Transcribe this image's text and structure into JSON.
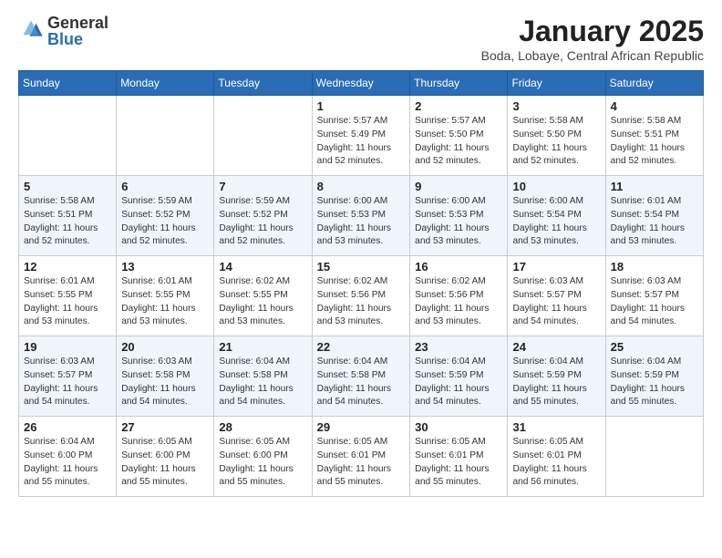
{
  "logo": {
    "general": "General",
    "blue": "Blue"
  },
  "title": "January 2025",
  "location": "Boda, Lobaye, Central African Republic",
  "days_of_week": [
    "Sunday",
    "Monday",
    "Tuesday",
    "Wednesday",
    "Thursday",
    "Friday",
    "Saturday"
  ],
  "weeks": [
    [
      {
        "day": "",
        "info": ""
      },
      {
        "day": "",
        "info": ""
      },
      {
        "day": "",
        "info": ""
      },
      {
        "day": "1",
        "info": "Sunrise: 5:57 AM\nSunset: 5:49 PM\nDaylight: 11 hours\nand 52 minutes."
      },
      {
        "day": "2",
        "info": "Sunrise: 5:57 AM\nSunset: 5:50 PM\nDaylight: 11 hours\nand 52 minutes."
      },
      {
        "day": "3",
        "info": "Sunrise: 5:58 AM\nSunset: 5:50 PM\nDaylight: 11 hours\nand 52 minutes."
      },
      {
        "day": "4",
        "info": "Sunrise: 5:58 AM\nSunset: 5:51 PM\nDaylight: 11 hours\nand 52 minutes."
      }
    ],
    [
      {
        "day": "5",
        "info": "Sunrise: 5:58 AM\nSunset: 5:51 PM\nDaylight: 11 hours\nand 52 minutes."
      },
      {
        "day": "6",
        "info": "Sunrise: 5:59 AM\nSunset: 5:52 PM\nDaylight: 11 hours\nand 52 minutes."
      },
      {
        "day": "7",
        "info": "Sunrise: 5:59 AM\nSunset: 5:52 PM\nDaylight: 11 hours\nand 52 minutes."
      },
      {
        "day": "8",
        "info": "Sunrise: 6:00 AM\nSunset: 5:53 PM\nDaylight: 11 hours\nand 53 minutes."
      },
      {
        "day": "9",
        "info": "Sunrise: 6:00 AM\nSunset: 5:53 PM\nDaylight: 11 hours\nand 53 minutes."
      },
      {
        "day": "10",
        "info": "Sunrise: 6:00 AM\nSunset: 5:54 PM\nDaylight: 11 hours\nand 53 minutes."
      },
      {
        "day": "11",
        "info": "Sunrise: 6:01 AM\nSunset: 5:54 PM\nDaylight: 11 hours\nand 53 minutes."
      }
    ],
    [
      {
        "day": "12",
        "info": "Sunrise: 6:01 AM\nSunset: 5:55 PM\nDaylight: 11 hours\nand 53 minutes."
      },
      {
        "day": "13",
        "info": "Sunrise: 6:01 AM\nSunset: 5:55 PM\nDaylight: 11 hours\nand 53 minutes."
      },
      {
        "day": "14",
        "info": "Sunrise: 6:02 AM\nSunset: 5:55 PM\nDaylight: 11 hours\nand 53 minutes."
      },
      {
        "day": "15",
        "info": "Sunrise: 6:02 AM\nSunset: 5:56 PM\nDaylight: 11 hours\nand 53 minutes."
      },
      {
        "day": "16",
        "info": "Sunrise: 6:02 AM\nSunset: 5:56 PM\nDaylight: 11 hours\nand 53 minutes."
      },
      {
        "day": "17",
        "info": "Sunrise: 6:03 AM\nSunset: 5:57 PM\nDaylight: 11 hours\nand 54 minutes."
      },
      {
        "day": "18",
        "info": "Sunrise: 6:03 AM\nSunset: 5:57 PM\nDaylight: 11 hours\nand 54 minutes."
      }
    ],
    [
      {
        "day": "19",
        "info": "Sunrise: 6:03 AM\nSunset: 5:57 PM\nDaylight: 11 hours\nand 54 minutes."
      },
      {
        "day": "20",
        "info": "Sunrise: 6:03 AM\nSunset: 5:58 PM\nDaylight: 11 hours\nand 54 minutes."
      },
      {
        "day": "21",
        "info": "Sunrise: 6:04 AM\nSunset: 5:58 PM\nDaylight: 11 hours\nand 54 minutes."
      },
      {
        "day": "22",
        "info": "Sunrise: 6:04 AM\nSunset: 5:58 PM\nDaylight: 11 hours\nand 54 minutes."
      },
      {
        "day": "23",
        "info": "Sunrise: 6:04 AM\nSunset: 5:59 PM\nDaylight: 11 hours\nand 54 minutes."
      },
      {
        "day": "24",
        "info": "Sunrise: 6:04 AM\nSunset: 5:59 PM\nDaylight: 11 hours\nand 55 minutes."
      },
      {
        "day": "25",
        "info": "Sunrise: 6:04 AM\nSunset: 5:59 PM\nDaylight: 11 hours\nand 55 minutes."
      }
    ],
    [
      {
        "day": "26",
        "info": "Sunrise: 6:04 AM\nSunset: 6:00 PM\nDaylight: 11 hours\nand 55 minutes."
      },
      {
        "day": "27",
        "info": "Sunrise: 6:05 AM\nSunset: 6:00 PM\nDaylight: 11 hours\nand 55 minutes."
      },
      {
        "day": "28",
        "info": "Sunrise: 6:05 AM\nSunset: 6:00 PM\nDaylight: 11 hours\nand 55 minutes."
      },
      {
        "day": "29",
        "info": "Sunrise: 6:05 AM\nSunset: 6:01 PM\nDaylight: 11 hours\nand 55 minutes."
      },
      {
        "day": "30",
        "info": "Sunrise: 6:05 AM\nSunset: 6:01 PM\nDaylight: 11 hours\nand 55 minutes."
      },
      {
        "day": "31",
        "info": "Sunrise: 6:05 AM\nSunset: 6:01 PM\nDaylight: 11 hours\nand 56 minutes."
      },
      {
        "day": "",
        "info": ""
      }
    ]
  ]
}
